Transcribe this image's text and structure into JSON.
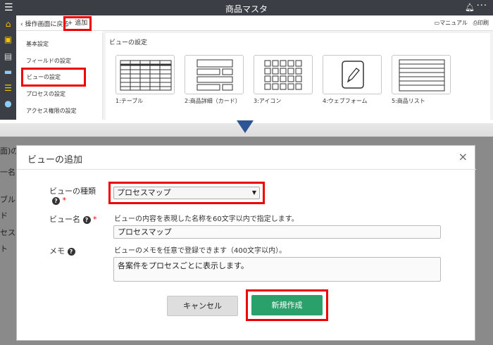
{
  "app": {
    "title": "商品マスタ",
    "menu_icon": "☰",
    "bell_icon": "🔔",
    "more_icon": "···"
  },
  "subbar": {
    "back_label": "操作画面に戻る",
    "add_label": "追加",
    "manual_label": "マニュアル",
    "print_label": "印刷"
  },
  "settings_menu": {
    "items": [
      "基本設定",
      "フィールドの設定",
      "ビューの設定",
      "プロセスの設定",
      "アクセス権限の設定"
    ]
  },
  "view_settings": {
    "title": "ビューの設定",
    "views": [
      {
        "label": "1:テーブル",
        "icon": "table-icon"
      },
      {
        "label": "2:商品詳細（カード）",
        "icon": "card-icon"
      },
      {
        "label": "3:アイコン",
        "icon": "icon-grid-icon"
      },
      {
        "label": "4:ウェブフォーム",
        "icon": "webform-icon"
      },
      {
        "label": "5:商品リスト",
        "icon": "list-icon"
      }
    ]
  },
  "background": {
    "fragments": [
      "面)の",
      "一名",
      "ブル",
      "ド",
      "セス",
      "ト"
    ]
  },
  "dialog": {
    "title": "ビューの追加",
    "close_icon": "×",
    "view_type": {
      "label": "ビューの種類",
      "required_mark": "*",
      "selected": "プロセスマップ"
    },
    "view_name": {
      "label": "ビュー名",
      "required_mark": "*",
      "hint": "ビューの内容を表現した名称を60文字以内で指定します。",
      "value": "プロセスマップ"
    },
    "memo": {
      "label": "メモ",
      "hint": "ビューのメモを任意で登録できます（400文字以内）。",
      "value": "各案件をプロセスごとに表示します。"
    },
    "cancel_label": "キャンセル",
    "create_label": "新規作成"
  },
  "colors": {
    "highlight": "#ee0000",
    "primary_button": "#2aa06b",
    "titlebar": "#3b3f45",
    "arrow": "#2d5596"
  }
}
